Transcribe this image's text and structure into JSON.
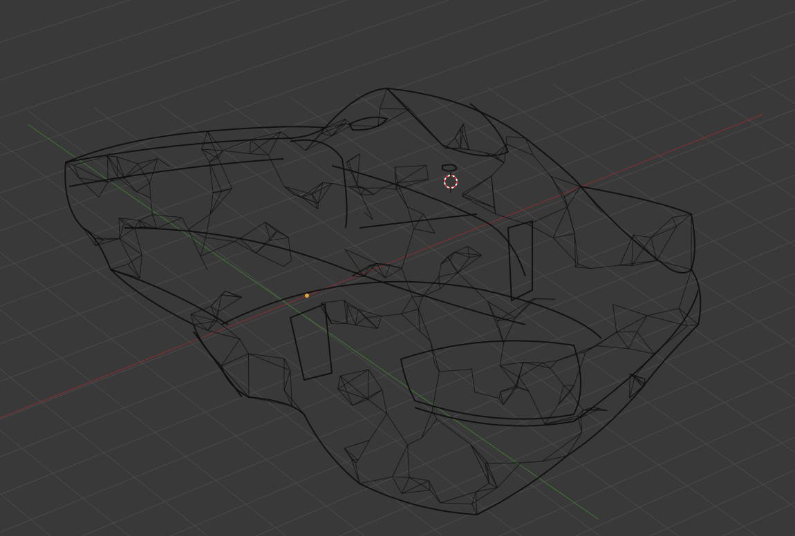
{
  "viewport": {
    "mode": "wireframe",
    "background_color": "#393939",
    "grid_color": "#4a4a4a",
    "x_axis_color": "#8a2f33",
    "y_axis_color": "#3f7a2f",
    "wire_color": "#0d0d0d"
  },
  "scene": {
    "object": "car-body-mesh",
    "cursor_icon": "3d-cursor-icon",
    "origin_icon": "object-origin-icon",
    "origin_color": "#e3a23a",
    "cursor_colors": [
      "#ff3b3b",
      "#ffffff"
    ]
  }
}
